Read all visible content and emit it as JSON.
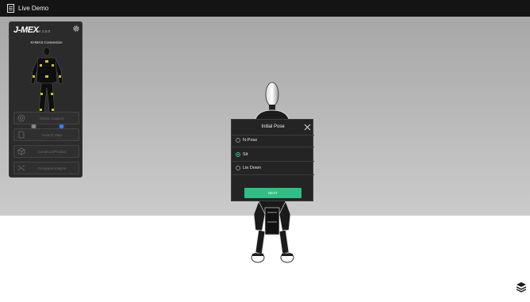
{
  "window": {
    "title": "Live Demo",
    "icon": "document-icon"
  },
  "panel": {
    "brand": "J-MEX",
    "version": "Ver 2.0.0",
    "settings_icon": "gear-icon",
    "connection_label": "KHMAS  Connection",
    "status_dots": [
      {
        "name": "gray",
        "color": "#8a8a8a"
      },
      {
        "name": "blue",
        "color": "#3f7fe2"
      }
    ],
    "menu": [
      {
        "label": "Motion Capture",
        "icon": "target-icon"
      },
      {
        "label": "Search Data",
        "icon": "file-icon"
      },
      {
        "label": "Construct/Product",
        "icon": "cube-icon"
      },
      {
        "label": "Compare/Analyze",
        "icon": "compare-icon"
      }
    ]
  },
  "dialog": {
    "title": "Initial Pose",
    "close_icon": "close-icon",
    "options": [
      {
        "label": "N-Pose",
        "selected": false
      },
      {
        "label": "Sit",
        "selected": true
      },
      {
        "label": "Lie Down",
        "selected": false
      }
    ],
    "next_label": "NEXT"
  },
  "scene": {
    "layers_icon": "layers-icon"
  },
  "colors": {
    "accent": "#2fbf84",
    "topbar": "#141414",
    "panel": "#2b2b2b",
    "dialog": "#242424"
  }
}
